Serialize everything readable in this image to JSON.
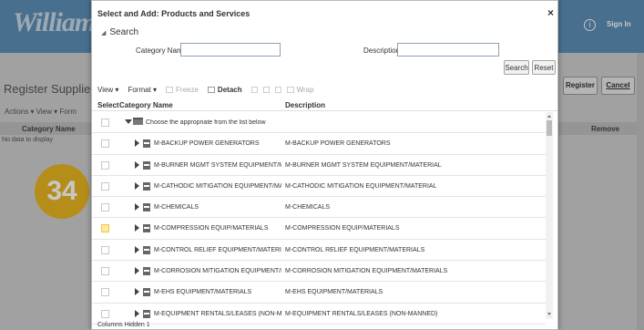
{
  "background": {
    "logo": "Williams.",
    "info_icon": "info-icon",
    "sign_in": "Sign In",
    "page_title": "Register Supplier:",
    "actions_bar": "Actions ▾  View ▾  Form",
    "table_header": "Category Name",
    "no_data": "No data to display",
    "register_button": "Register",
    "cancel_button": "Cancel",
    "remove_header": "Remove",
    "step_badge": "34"
  },
  "dialog": {
    "title": "Select and Add: Products and Services",
    "close": "×",
    "search": {
      "header": "Search",
      "category_label": "Category Name",
      "category_value": "",
      "description_label": "Description",
      "description_value": "",
      "search_button": "Search",
      "reset_button": "Reset"
    },
    "toolbar": {
      "view": "View ▾",
      "format": "Format ▾",
      "freeze": "Freeze",
      "detach": "Detach",
      "wrap": "Wrap"
    },
    "columns": {
      "select": "Select",
      "category": "Category Name",
      "description": "Description"
    },
    "root_row": "Choose the appropriate from the list below",
    "rows": [
      {
        "category": "M-BACKUP POWER GENERATORS",
        "description": "M-BACKUP POWER GENERATORS"
      },
      {
        "category": "M-BURNER MGMT SYSTEM EQUIPMENT/MATER",
        "description": "M-BURNER MGMT SYSTEM EQUIPMENT/MATERIAL"
      },
      {
        "category": "M-CATHODIC MITIGATION EQUIPMENT/MATERIA",
        "description": "M-CATHODIC MITIGATION EQUIPMENT/MATERIAL"
      },
      {
        "category": "M-CHEMICALS",
        "description": "M-CHEMICALS"
      },
      {
        "category": "M-COMPRESSION EQUIP/MATERIALS",
        "description": "M-COMPRESSION EQUIP/MATERIALS"
      },
      {
        "category": "M-CONTROL RELIEF EQUIPMENT/MATERIALS",
        "description": "M-CONTROL RELIEF EQUIPMENT/MATERIALS"
      },
      {
        "category": "M-CORROSION MITIGATION EQUIPMENT/MATEF",
        "description": "M-CORROSION MITIGATION EQUIPMENT/MATERIALS"
      },
      {
        "category": "M-EHS EQUIPMENT/MATERIALS",
        "description": "M-EHS EQUIPMENT/MATERIALS"
      },
      {
        "category": "M-EQUIPMENT RENTALS/LEASES (NON-MANNEI",
        "description": "M-EQUIPMENT RENTALS/LEASES (NON-MANNED)"
      }
    ],
    "footer": "Columns Hidden  1"
  }
}
